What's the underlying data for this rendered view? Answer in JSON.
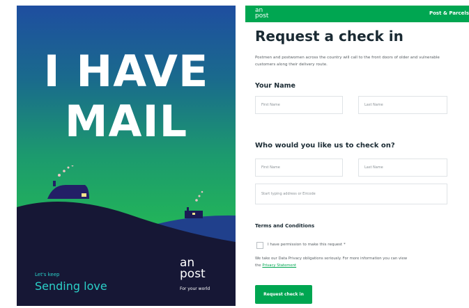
{
  "poster": {
    "headline_line1": "I HAVE",
    "headline_line2": "MAIL",
    "tagline_small": "Let's keep",
    "tagline_big": "Sending love",
    "logo_top": "an",
    "logo_bottom": "post",
    "logo_tagline": "For your world",
    "colors": {
      "sky_top": "#1e4ea0",
      "sky_bottom": "#2bbd57",
      "hill": "#161735",
      "tagline": "#2bd0c8"
    }
  },
  "form": {
    "header": {
      "logo_top": "an",
      "logo_bottom": "post",
      "nav_link": "Post & Parcels"
    },
    "title": "Request a check in",
    "intro": "Postmen and postwomen across the country will call to the front doors of older and vulnerable customers along their delivery route.",
    "your_name": {
      "heading": "Your Name",
      "first_placeholder": "First Name",
      "last_placeholder": "Last Name"
    },
    "check_on": {
      "heading": "Who would you like us to check on?",
      "first_placeholder": "First Name",
      "last_placeholder": "Last Name",
      "address_placeholder": "Start typing address or Eircode"
    },
    "terms": {
      "heading": "Terms and Conditions",
      "checkbox_label": "I have permission to make this request *",
      "privacy_text": "We take our Data Privacy obligations seriously. For more information you can view",
      "privacy_link_prefix": "the",
      "privacy_link": "Privacy Statement"
    },
    "submit_label": "Request check in",
    "colors": {
      "brand": "#00a651",
      "heading": "#1a2a33",
      "body": "#555c61"
    }
  }
}
